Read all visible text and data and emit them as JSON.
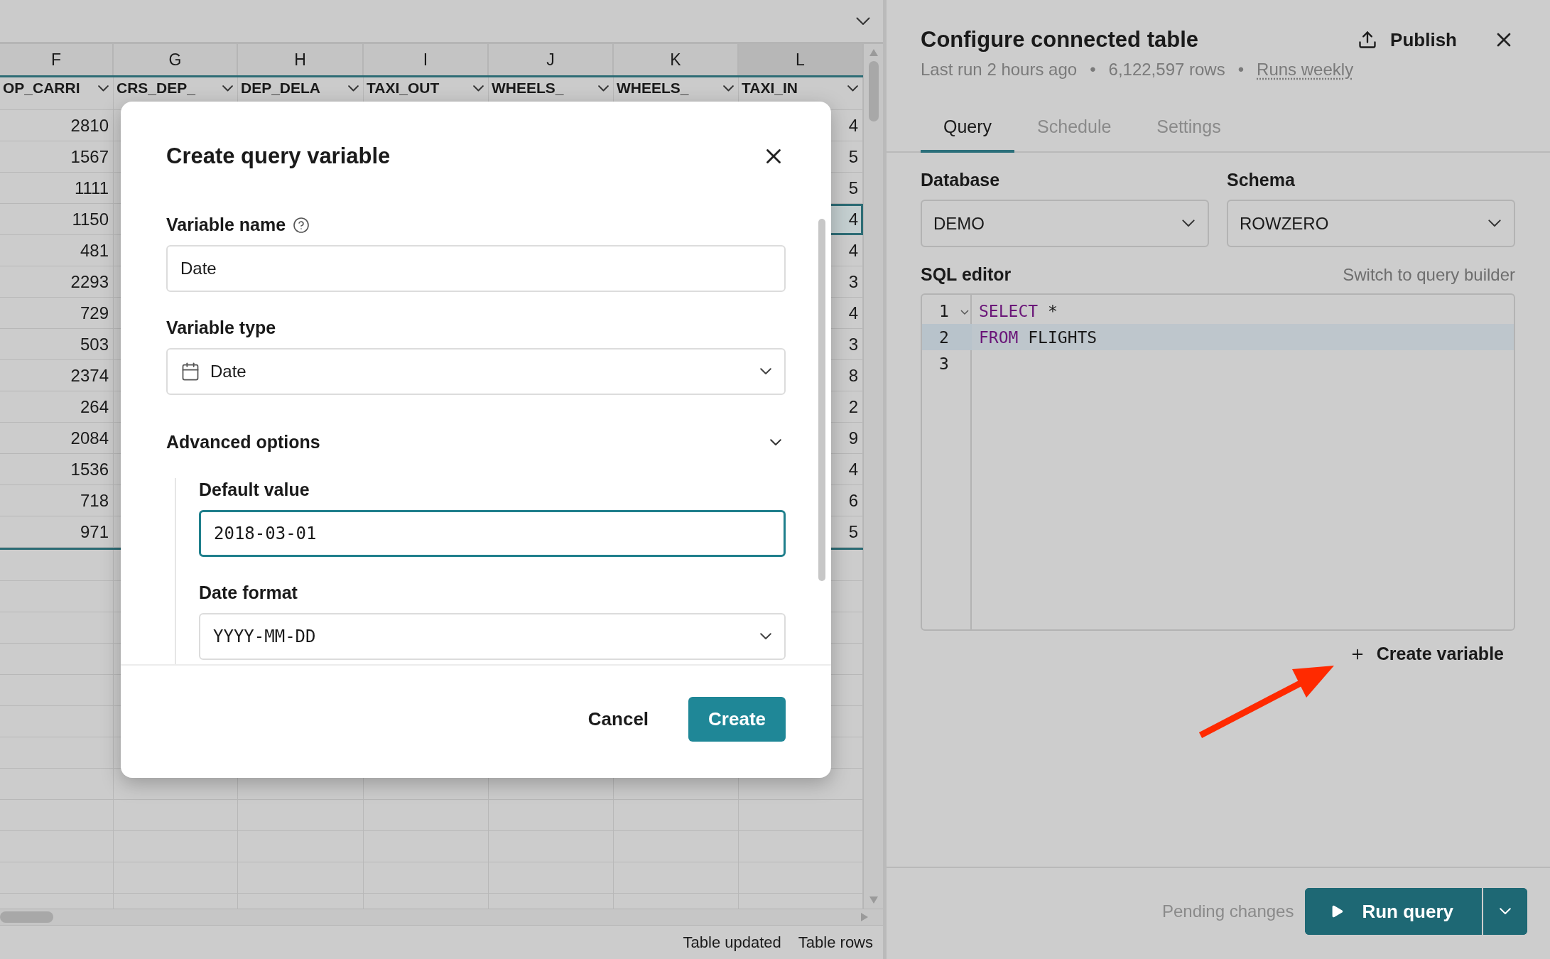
{
  "sheet": {
    "columns": [
      {
        "letter": "F",
        "field": "OP_CARRI",
        "selected": false
      },
      {
        "letter": "G",
        "field": "CRS_DEP_",
        "selected": false
      },
      {
        "letter": "H",
        "field": "DEP_DELA",
        "selected": false
      },
      {
        "letter": "I",
        "field": "TAXI_OUT",
        "selected": false
      },
      {
        "letter": "J",
        "field": "WHEELS_",
        "selected": false
      },
      {
        "letter": "K",
        "field": "WHEELS_",
        "selected": false
      },
      {
        "letter": "L",
        "field": "TAXI_IN",
        "selected": true
      }
    ],
    "rows": [
      {
        "column_f": "2810",
        "column_l": "4",
        "selected": false
      },
      {
        "column_f": "1567",
        "column_l": "5",
        "selected": false
      },
      {
        "column_f": "1111",
        "column_l": "5",
        "selected": false
      },
      {
        "column_f": "1150",
        "column_l": "4",
        "selected": true
      },
      {
        "column_f": "481",
        "column_l": "4",
        "selected": false
      },
      {
        "column_f": "2293",
        "column_l": "3",
        "selected": false
      },
      {
        "column_f": "729",
        "column_l": "4",
        "selected": false
      },
      {
        "column_f": "503",
        "column_l": "3",
        "selected": false
      },
      {
        "column_f": "2374",
        "column_l": "8",
        "selected": false
      },
      {
        "column_f": "264",
        "column_l": "2",
        "selected": false
      },
      {
        "column_f": "2084",
        "column_l": "9",
        "selected": false
      },
      {
        "column_f": "1536",
        "column_l": "4",
        "selected": false
      },
      {
        "column_f": "718",
        "column_l": "6",
        "selected": false
      },
      {
        "column_f": "971",
        "column_l": "5",
        "selected": false
      }
    ],
    "status_bar": [
      "Table updated",
      "Table rows"
    ]
  },
  "dialog": {
    "title": "Create query variable",
    "variable_name": {
      "label": "Variable name",
      "value": "Date"
    },
    "variable_type": {
      "label": "Variable type",
      "value": "Date"
    },
    "advanced": {
      "label": "Advanced options",
      "expanded": true,
      "default_value": {
        "label": "Default value",
        "value": "2018-03-01",
        "focused": true
      },
      "date_format": {
        "label": "Date format",
        "value": "YYYY-MM-DD"
      }
    },
    "buttons": [
      {
        "label": "Cancel",
        "kind": "secondary"
      },
      {
        "label": "Create",
        "kind": "primary"
      }
    ]
  },
  "panel": {
    "title": "Configure connected table",
    "publish": "Publish",
    "meta": [
      "Last run 2 hours ago",
      "•",
      "6,122,597 rows",
      "•"
    ],
    "schedule_link": "Runs weekly",
    "tabs": [
      {
        "label": "Query",
        "selected": true
      },
      {
        "label": "Schedule",
        "selected": false
      },
      {
        "label": "Settings",
        "selected": false
      }
    ],
    "database": {
      "label": "Database",
      "value": "DEMO"
    },
    "schema": {
      "label": "Schema",
      "value": "ROWZERO"
    },
    "editor": {
      "label": "SQL editor",
      "switch_link": "Switch to query builder",
      "lines": [
        {
          "number": "1",
          "foldable": true,
          "selected": false,
          "tokens": [
            {
              "kind": "keyword",
              "text": "SELECT"
            },
            {
              "kind": "plain",
              "text": " *"
            }
          ]
        },
        {
          "number": "2",
          "foldable": false,
          "selected": true,
          "tokens": [
            {
              "kind": "keyword",
              "text": "FROM"
            },
            {
              "kind": "plain",
              "text": " FLIGHTS"
            }
          ]
        },
        {
          "number": "3",
          "foldable": false,
          "selected": false
        }
      ]
    },
    "create_variable": "Create variable",
    "pending": "Pending changes",
    "run_button": "Run query"
  }
}
